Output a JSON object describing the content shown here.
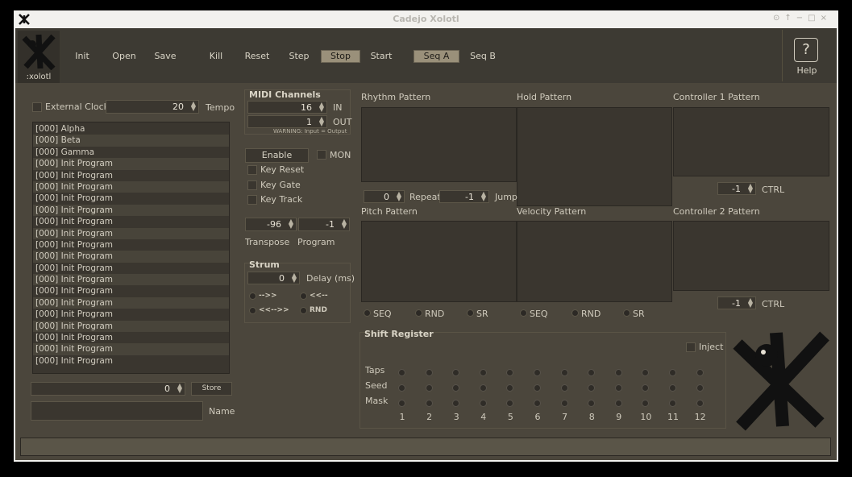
{
  "window": {
    "title": "Cadejo Xolotl",
    "controls": [
      "⊙",
      "↑",
      "−",
      "□",
      "×"
    ]
  },
  "logo": {
    "label": ":xolotl"
  },
  "toolbar": {
    "init": "Init",
    "open": "Open",
    "save": "Save",
    "kill": "Kill",
    "reset": "Reset",
    "step": "Step",
    "stop": "Stop",
    "start": "Start",
    "seq_a": "Seq A",
    "seq_b": "Seq B",
    "help": "Help"
  },
  "clock": {
    "external_label": "External Clock",
    "tempo_value": "20",
    "tempo_label": "Tempo"
  },
  "programs": [
    "[000] Alpha",
    "[000] Beta",
    "[000] Gamma",
    "[000] Init Program",
    "[000] Init Program",
    "[000] Init Program",
    "[000] Init Program",
    "[000] Init Program",
    "[000] Init Program",
    "[000] Init Program",
    "[000] Init Program",
    "[000] Init Program",
    "[000] Init Program",
    "[000] Init Program",
    "[000] Init Program",
    "[000] Init Program",
    "[000] Init Program",
    "[000] Init Program",
    "[000] Init Program",
    "[000] Init Program",
    "[000] Init Program"
  ],
  "store": {
    "value": "0",
    "button": "Store",
    "name_label": "Name",
    "name_value": ""
  },
  "midi": {
    "title": "MIDI Channels",
    "in_value": "16",
    "in_label": "IN",
    "out_value": "1",
    "out_label": "OUT",
    "warning": "WARNING: Input = Output",
    "enable": "Enable",
    "mon": "MON",
    "key_reset": "Key Reset",
    "key_gate": "Key Gate",
    "key_track": "Key Track",
    "transpose_value": "-96",
    "program_value": "-1",
    "transpose_label": "Transpose",
    "program_label": "Program"
  },
  "strum": {
    "title": "Strum",
    "delay_value": "0",
    "delay_label": "Delay (ms)",
    "opt1": "-->>",
    "opt2": "<<--",
    "opt3": "<<-->>",
    "opt4": "RND"
  },
  "patterns": {
    "rhythm": "Rhythm Pattern",
    "hold": "Hold Pattern",
    "ctrl1": "Controller 1 Pattern",
    "repeat_value": "0",
    "repeat_label": "Repeat",
    "jump_value": "-1",
    "jump_label": "Jump",
    "ctrl1_value": "-1",
    "ctrl1_label": "CTRL",
    "pitch": "Pitch Pattern",
    "velocity": "Velocity Pattern",
    "ctrl2": "Controller 2 Pattern",
    "ctrl2_value": "-1",
    "ctrl2_label": "CTRL",
    "seq": "SEQ",
    "rnd": "RND",
    "sr": "SR"
  },
  "shift_register": {
    "title": "Shift Register",
    "inject": "Inject",
    "rows": [
      "Taps",
      "Seed",
      "Mask"
    ],
    "columns": [
      "1",
      "2",
      "3",
      "4",
      "5",
      "6",
      "7",
      "8",
      "9",
      "10",
      "11",
      "12"
    ]
  }
}
